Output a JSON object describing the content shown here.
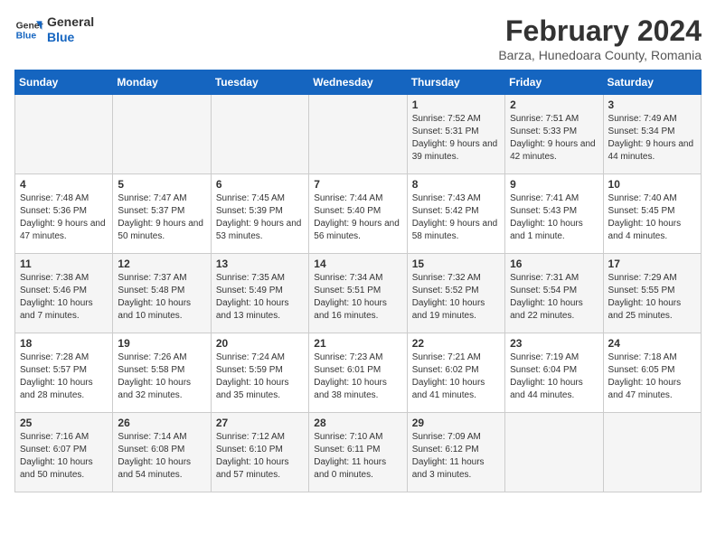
{
  "logo": {
    "line1": "General",
    "line2": "Blue"
  },
  "title": "February 2024",
  "subtitle": "Barza, Hunedoara County, Romania",
  "weekdays": [
    "Sunday",
    "Monday",
    "Tuesday",
    "Wednesday",
    "Thursday",
    "Friday",
    "Saturday"
  ],
  "weeks": [
    [
      {
        "day": "",
        "sunrise": "",
        "sunset": "",
        "daylight": ""
      },
      {
        "day": "",
        "sunrise": "",
        "sunset": "",
        "daylight": ""
      },
      {
        "day": "",
        "sunrise": "",
        "sunset": "",
        "daylight": ""
      },
      {
        "day": "",
        "sunrise": "",
        "sunset": "",
        "daylight": ""
      },
      {
        "day": "1",
        "sunrise": "Sunrise: 7:52 AM",
        "sunset": "Sunset: 5:31 PM",
        "daylight": "Daylight: 9 hours and 39 minutes."
      },
      {
        "day": "2",
        "sunrise": "Sunrise: 7:51 AM",
        "sunset": "Sunset: 5:33 PM",
        "daylight": "Daylight: 9 hours and 42 minutes."
      },
      {
        "day": "3",
        "sunrise": "Sunrise: 7:49 AM",
        "sunset": "Sunset: 5:34 PM",
        "daylight": "Daylight: 9 hours and 44 minutes."
      }
    ],
    [
      {
        "day": "4",
        "sunrise": "Sunrise: 7:48 AM",
        "sunset": "Sunset: 5:36 PM",
        "daylight": "Daylight: 9 hours and 47 minutes."
      },
      {
        "day": "5",
        "sunrise": "Sunrise: 7:47 AM",
        "sunset": "Sunset: 5:37 PM",
        "daylight": "Daylight: 9 hours and 50 minutes."
      },
      {
        "day": "6",
        "sunrise": "Sunrise: 7:45 AM",
        "sunset": "Sunset: 5:39 PM",
        "daylight": "Daylight: 9 hours and 53 minutes."
      },
      {
        "day": "7",
        "sunrise": "Sunrise: 7:44 AM",
        "sunset": "Sunset: 5:40 PM",
        "daylight": "Daylight: 9 hours and 56 minutes."
      },
      {
        "day": "8",
        "sunrise": "Sunrise: 7:43 AM",
        "sunset": "Sunset: 5:42 PM",
        "daylight": "Daylight: 9 hours and 58 minutes."
      },
      {
        "day": "9",
        "sunrise": "Sunrise: 7:41 AM",
        "sunset": "Sunset: 5:43 PM",
        "daylight": "Daylight: 10 hours and 1 minute."
      },
      {
        "day": "10",
        "sunrise": "Sunrise: 7:40 AM",
        "sunset": "Sunset: 5:45 PM",
        "daylight": "Daylight: 10 hours and 4 minutes."
      }
    ],
    [
      {
        "day": "11",
        "sunrise": "Sunrise: 7:38 AM",
        "sunset": "Sunset: 5:46 PM",
        "daylight": "Daylight: 10 hours and 7 minutes."
      },
      {
        "day": "12",
        "sunrise": "Sunrise: 7:37 AM",
        "sunset": "Sunset: 5:48 PM",
        "daylight": "Daylight: 10 hours and 10 minutes."
      },
      {
        "day": "13",
        "sunrise": "Sunrise: 7:35 AM",
        "sunset": "Sunset: 5:49 PM",
        "daylight": "Daylight: 10 hours and 13 minutes."
      },
      {
        "day": "14",
        "sunrise": "Sunrise: 7:34 AM",
        "sunset": "Sunset: 5:51 PM",
        "daylight": "Daylight: 10 hours and 16 minutes."
      },
      {
        "day": "15",
        "sunrise": "Sunrise: 7:32 AM",
        "sunset": "Sunset: 5:52 PM",
        "daylight": "Daylight: 10 hours and 19 minutes."
      },
      {
        "day": "16",
        "sunrise": "Sunrise: 7:31 AM",
        "sunset": "Sunset: 5:54 PM",
        "daylight": "Daylight: 10 hours and 22 minutes."
      },
      {
        "day": "17",
        "sunrise": "Sunrise: 7:29 AM",
        "sunset": "Sunset: 5:55 PM",
        "daylight": "Daylight: 10 hours and 25 minutes."
      }
    ],
    [
      {
        "day": "18",
        "sunrise": "Sunrise: 7:28 AM",
        "sunset": "Sunset: 5:57 PM",
        "daylight": "Daylight: 10 hours and 28 minutes."
      },
      {
        "day": "19",
        "sunrise": "Sunrise: 7:26 AM",
        "sunset": "Sunset: 5:58 PM",
        "daylight": "Daylight: 10 hours and 32 minutes."
      },
      {
        "day": "20",
        "sunrise": "Sunrise: 7:24 AM",
        "sunset": "Sunset: 5:59 PM",
        "daylight": "Daylight: 10 hours and 35 minutes."
      },
      {
        "day": "21",
        "sunrise": "Sunrise: 7:23 AM",
        "sunset": "Sunset: 6:01 PM",
        "daylight": "Daylight: 10 hours and 38 minutes."
      },
      {
        "day": "22",
        "sunrise": "Sunrise: 7:21 AM",
        "sunset": "Sunset: 6:02 PM",
        "daylight": "Daylight: 10 hours and 41 minutes."
      },
      {
        "day": "23",
        "sunrise": "Sunrise: 7:19 AM",
        "sunset": "Sunset: 6:04 PM",
        "daylight": "Daylight: 10 hours and 44 minutes."
      },
      {
        "day": "24",
        "sunrise": "Sunrise: 7:18 AM",
        "sunset": "Sunset: 6:05 PM",
        "daylight": "Daylight: 10 hours and 47 minutes."
      }
    ],
    [
      {
        "day": "25",
        "sunrise": "Sunrise: 7:16 AM",
        "sunset": "Sunset: 6:07 PM",
        "daylight": "Daylight: 10 hours and 50 minutes."
      },
      {
        "day": "26",
        "sunrise": "Sunrise: 7:14 AM",
        "sunset": "Sunset: 6:08 PM",
        "daylight": "Daylight: 10 hours and 54 minutes."
      },
      {
        "day": "27",
        "sunrise": "Sunrise: 7:12 AM",
        "sunset": "Sunset: 6:10 PM",
        "daylight": "Daylight: 10 hours and 57 minutes."
      },
      {
        "day": "28",
        "sunrise": "Sunrise: 7:10 AM",
        "sunset": "Sunset: 6:11 PM",
        "daylight": "Daylight: 11 hours and 0 minutes."
      },
      {
        "day": "29",
        "sunrise": "Sunrise: 7:09 AM",
        "sunset": "Sunset: 6:12 PM",
        "daylight": "Daylight: 11 hours and 3 minutes."
      },
      {
        "day": "",
        "sunrise": "",
        "sunset": "",
        "daylight": ""
      },
      {
        "day": "",
        "sunrise": "",
        "sunset": "",
        "daylight": ""
      }
    ]
  ]
}
